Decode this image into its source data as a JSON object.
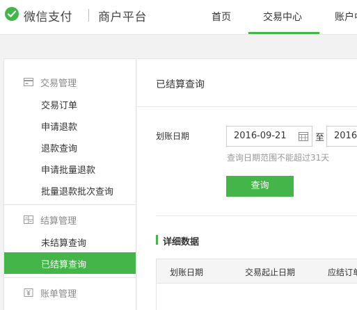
{
  "header": {
    "brand": "微信支付",
    "platform": "商户平台",
    "nav": [
      "首页",
      "交易中心",
      "账户中"
    ],
    "active_nav": "交易中心",
    "accent_color": "#44b549"
  },
  "sidebar": {
    "groups": [
      {
        "label": "交易管理",
        "icon": "transaction-card-icon",
        "items": [
          "交易订单",
          "申请退款",
          "退款查询",
          "申请批量退款",
          "批量退款批次查询"
        ]
      },
      {
        "label": "结算管理",
        "icon": "settlement-calculator-icon",
        "items": [
          "未结算查询",
          "已结算查询"
        ]
      },
      {
        "label": "账单管理",
        "icon": "bill-yen-icon",
        "items": []
      }
    ],
    "active_item": "已结算查询"
  },
  "main": {
    "title": "已结算查询",
    "filter": {
      "label": "划账日期",
      "start_date": "2016-09-21",
      "to_label": "至",
      "end_date": "2016-",
      "hint": "查询日期范围不能超过31天",
      "query_button": "查询"
    },
    "section_title": "详细数据",
    "table": {
      "columns": [
        "划账日期",
        "交易起止日期",
        "应结订单"
      ],
      "rows": []
    }
  }
}
